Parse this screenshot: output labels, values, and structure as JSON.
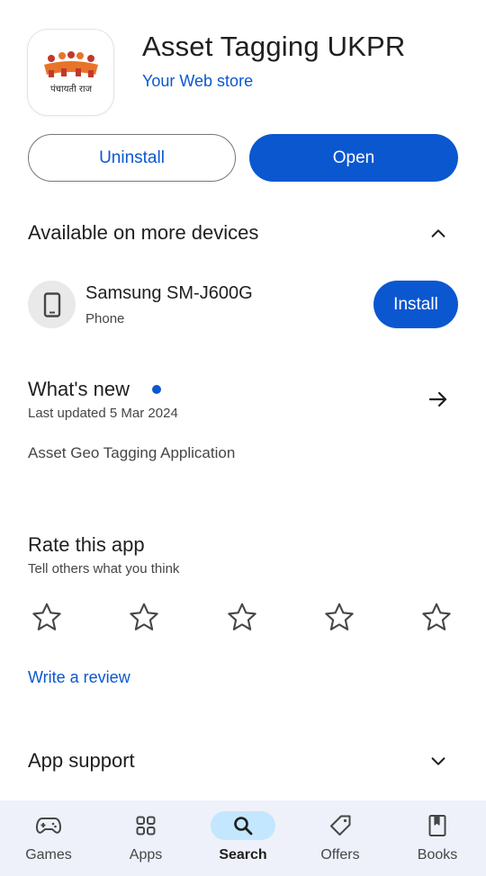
{
  "app": {
    "title": "Asset Tagging UKPR",
    "developer": "Your Web store",
    "logo_text": "पंचायती राज"
  },
  "actions": {
    "uninstall_label": "Uninstall",
    "open_label": "Open"
  },
  "devices": {
    "heading": "Available on more devices",
    "device_name": "Samsung SM-J600G",
    "device_type": "Phone",
    "install_label": "Install"
  },
  "whats_new": {
    "heading": "What's new",
    "updated": "Last updated 5 Mar 2024",
    "notes": "Asset Geo Tagging Application"
  },
  "rate": {
    "heading": "Rate this app",
    "subheading": "Tell others what you think",
    "stars": 5,
    "review_link": "Write a review"
  },
  "support": {
    "heading": "App support"
  },
  "nav": {
    "items": [
      {
        "label": "Games",
        "icon": "gamepad-icon",
        "active": false
      },
      {
        "label": "Apps",
        "icon": "apps-grid-icon",
        "active": false
      },
      {
        "label": "Search",
        "icon": "search-icon",
        "active": true
      },
      {
        "label": "Offers",
        "icon": "offer-tag-icon",
        "active": false
      },
      {
        "label": "Books",
        "icon": "book-icon",
        "active": false
      }
    ]
  },
  "colors": {
    "accent": "#0b57d0",
    "nav_background": "#eef1f9",
    "nav_active_pill": "#c2e7ff",
    "logo_orange": "#e8742a",
    "logo_red": "#c0392b"
  }
}
